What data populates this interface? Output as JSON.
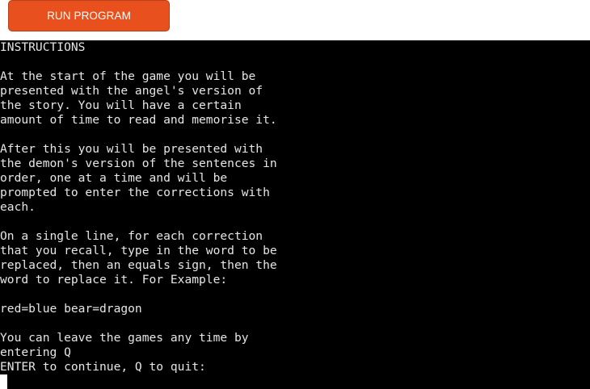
{
  "toolbar": {
    "run_label": "RUN PROGRAM"
  },
  "terminal": {
    "lines": [
      "INSTRUCTIONS",
      "",
      "At the start of the game you will be",
      "presented with the angel's version of",
      "the story. You will have a certain",
      "amount of time to read and memorise it.",
      "",
      "After this you will be presented with",
      "the demon's version of the sentences in",
      "order, one at a time and will be",
      "prompted to enter the corrections with",
      "each.",
      "",
      "On a single line, for each correction",
      "that you recall, type in the word to be",
      "replaced, then an equals sign, then the",
      "word to replace it. For Example:",
      "",
      "red=blue bear=dragon",
      "",
      "You can leave the games any time by",
      "entering Q",
      "ENTER to continue, Q to quit:"
    ]
  },
  "colors": {
    "button_bg": "#e8501d",
    "terminal_bg": "#000000",
    "terminal_fg": "#e6e6e6"
  }
}
